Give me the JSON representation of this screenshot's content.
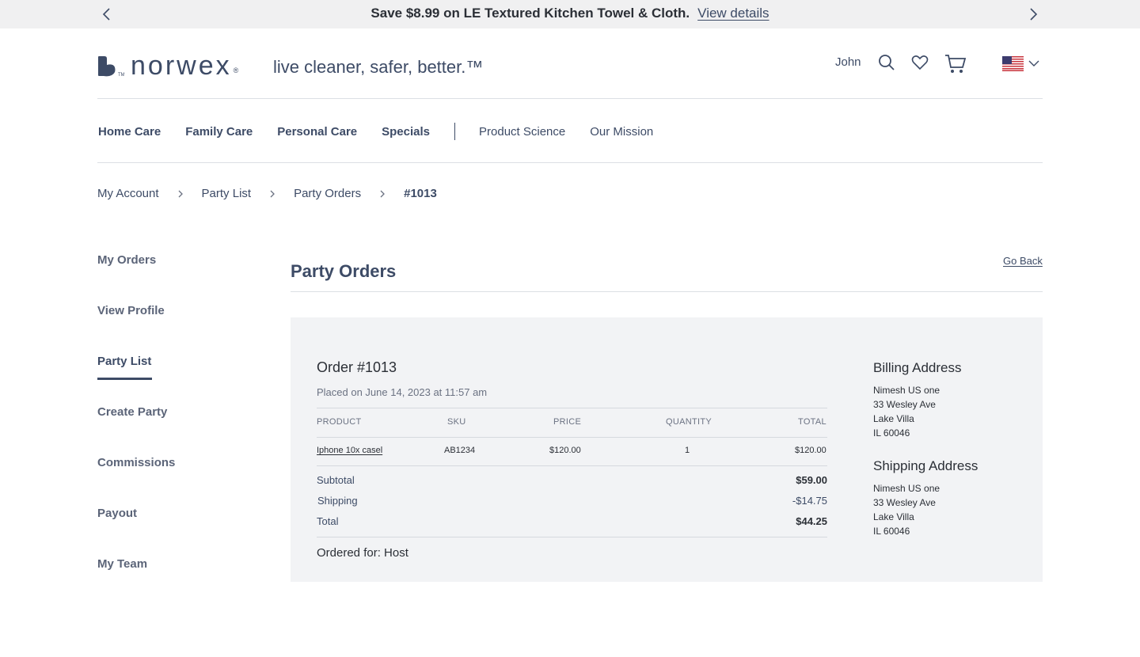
{
  "promo": {
    "message": "Save $8.99 on LE Textured Kitchen Towel & Cloth.",
    "link": "View details"
  },
  "header": {
    "logo_text": "norwex",
    "tagline": "live cleaner, safer, better.™",
    "user_name": "John",
    "icons": [
      "search-icon",
      "heart-icon",
      "cart-icon",
      "us-flag-icon",
      "chevron-down-icon"
    ]
  },
  "nav": {
    "primary": [
      "Home Care",
      "Family Care",
      "Personal Care",
      "Specials"
    ],
    "secondary": [
      "Product Science",
      "Our Mission"
    ]
  },
  "breadcrumb": [
    "My Account",
    "Party List",
    "Party Orders",
    "#1013"
  ],
  "sidebar": {
    "items": [
      "My Orders",
      "View Profile",
      "Party List",
      "Create Party",
      "Commissions",
      "Payout",
      "My Team"
    ],
    "active": "Party List"
  },
  "page": {
    "title": "Party Orders",
    "go_back": "Go Back"
  },
  "order": {
    "title": "Order #1013",
    "placed": "Placed on June 14, 2023 at 11:57 am",
    "columns": [
      "PRODUCT",
      "SKU",
      "PRICE",
      "QUANTITY",
      "TOTAL"
    ],
    "rows": [
      {
        "product": "Iphone 10x casel",
        "sku": "AB1234",
        "price": "$120.00",
        "quantity": "1",
        "total": "$120.00"
      }
    ],
    "summary": {
      "subtotal_label": "Subtotal",
      "subtotal": "$59.00",
      "shipping_label": "Shipping",
      "shipping": "-$14.75",
      "total_label": "Total",
      "total": "$44.25"
    },
    "ordered_for": "Ordered for: Host"
  },
  "billing": {
    "heading": "Billing Address",
    "lines": [
      "Nimesh US one",
      "33 Wesley Ave",
      "Lake Villa",
      "IL 60046"
    ]
  },
  "shipping": {
    "heading": "Shipping Address",
    "lines": [
      "Nimesh US one",
      "33 Wesley Ave",
      "Lake Villa",
      "IL 60046"
    ]
  },
  "colors": {
    "primary": "#3d4b66",
    "promo_bg": "#f0f0f1",
    "panel_bg": "#f2f3f5"
  }
}
